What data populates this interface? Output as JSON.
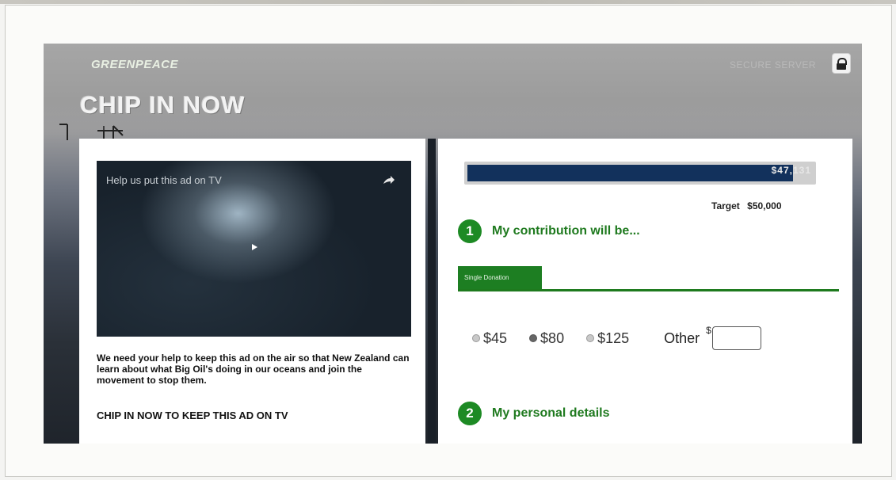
{
  "header": {
    "logo_text": "GREENPEACE",
    "secure_label": "SECURE SERVER",
    "headline": "CHIP IN NOW"
  },
  "video": {
    "title": "Help us put this ad on TV",
    "description": "We need your help to keep this ad on the air so that New Zealand can learn about what Big Oil's doing in our oceans and join the movement to stop them.",
    "cta": "CHIP IN NOW TO KEEP THIS AD ON TV"
  },
  "progress": {
    "raised_label": "$47,131",
    "target_label": "Target",
    "target_value": "$50,000",
    "fill_fraction": 0.94262
  },
  "steps": [
    {
      "number": "1",
      "label": "My contribution will be..."
    },
    {
      "number": "2",
      "label": "My personal details"
    }
  ],
  "tabs": [
    {
      "label": "Single Donation"
    }
  ],
  "amounts": [
    {
      "label": "$45",
      "selected": false
    },
    {
      "label": "$80",
      "selected": true
    },
    {
      "label": "$125",
      "selected": false
    }
  ],
  "other": {
    "label": "Other",
    "currency": "$",
    "value": ""
  },
  "colors": {
    "accent_green": "#1d8a24",
    "progress_navy": "#12315c"
  }
}
